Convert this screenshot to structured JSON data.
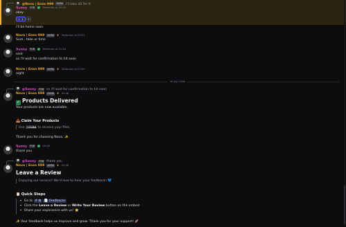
{
  "header_reply": {
    "author": "@Nova | Enzo 999",
    "tag": "AURA",
    "text": "i'll take $5 for it"
  },
  "messages": [
    {
      "author": "Sunny",
      "tag": "FDB",
      "time": "Yesterday at 20:00",
      "text": "okay"
    },
    {
      "text": "i'll be home soon"
    },
    {
      "author": "Nova | Enzo 999",
      "tag": "AURA",
      "time": "Yesterday at 20:03",
      "text": "Sure.. take ur time"
    },
    {
      "author": "Sunny",
      "tag": "FDB",
      "time": "Yesterday at 21:04",
      "text": "sent"
    },
    {
      "text": "so i'll wait for confirmation to hit soon"
    },
    {
      "author": "Nova | Enzo 999",
      "tag": "AURA",
      "time": "Yesterday at 22:05",
      "text": "aight"
    }
  ],
  "reactions": {
    "first": "+",
    "first_count": "1",
    "add": "+"
  },
  "date_divider": "16 July 2026",
  "delivery": {
    "reply_author": "@Sunny",
    "reply_tag": "FDB",
    "reply_text": "so i'll wait for confirmation to hit soon",
    "author": "Nova | Enzo 999",
    "tag": "AURA",
    "time": "00:46",
    "title": "Products Delivered",
    "subtitle": "Your products are now available.",
    "claim_heading": "Claim Your Products",
    "claim_pre": "Use",
    "claim_code": "/claim",
    "claim_post": "to receive your files.",
    "thanks": "Thank you for choosing Nova."
  },
  "sunny_thanks": {
    "author": "Sunny",
    "tag": "FDB",
    "time": "00:46",
    "text": "thank you"
  },
  "review": {
    "reply_author": "@Sunny",
    "reply_tag": "FDB",
    "reply_text": "thank you",
    "author": "Nova | Enzo 999",
    "tag": "AURA",
    "time": "00:46",
    "title": "Leave a Review",
    "intro": "Enjoying our service? We'd love to hear your feedback!",
    "steps_heading": "Quick Steps",
    "step1_pre": "Go to",
    "step1_chan_a": "# ✿",
    "step1_chan_b": "feedbacks",
    "step2_pre": "Click the",
    "step2_b1": "Leave a Review",
    "step2_mid": "or",
    "step2_b2": "Write Your Review",
    "step2_post": "button on the embed",
    "step3": "Share your experience with us!",
    "footer": "Your feedback helps us improve and grow. Thank you for your support!"
  },
  "colors": {
    "accent": "#5865f2",
    "sunny": "#e24fd0",
    "nova": "#e8a733",
    "success": "#248046"
  }
}
